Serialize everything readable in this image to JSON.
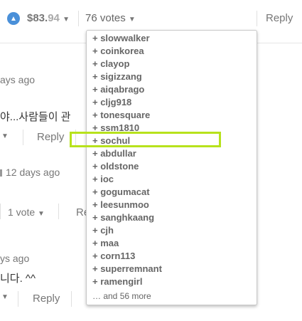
{
  "topbar": {
    "payout_dollars": "$83.",
    "payout_cents": "94",
    "votes_label": "76 votes",
    "reply_label": "Reply"
  },
  "comments": {
    "c1_time": "ays ago",
    "c1_text": "야...사람들이 관",
    "c1_reply": "Reply",
    "c2_time": "12 days ago",
    "c2_votes": "1 vote",
    "c2_reply_fragment": "Re",
    "c3_time": "ys ago",
    "c3_text": "니다. ^^",
    "c3_reply": "Reply"
  },
  "voters_dropdown": {
    "items": [
      "+ slowwalker",
      "+ coinkorea",
      "+ clayop",
      "+ sigizzang",
      "+ aiqabrago",
      "+ cljg918",
      "+ tonesquare",
      "+ ssm1810",
      "+ sochul",
      "+ abdullar",
      "+ oldstone",
      "+ ioc",
      "+ gogumacat",
      "+ leesunmoo",
      "+ sanghkaang",
      "+ cjh",
      "+ maa",
      "+ corn113",
      "+ superremnant",
      "+ ramengirl"
    ],
    "more_label": "… and 56 more",
    "highlight_color": "#b7e21c"
  },
  "colors": {
    "upvote": "#4a90d9"
  }
}
